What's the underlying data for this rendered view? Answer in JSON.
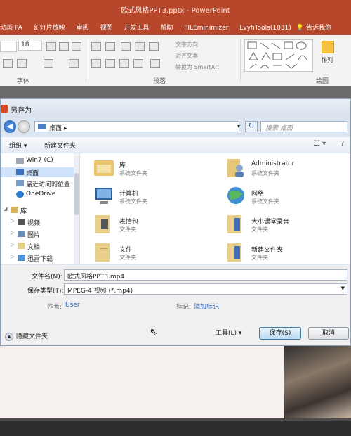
{
  "powerpoint": {
    "title": "欧式风格PPT3.pptx - PowerPoint",
    "menu": [
      "动画",
      "幻灯片放映",
      "审阅",
      "视图",
      "开发工具",
      "帮助",
      "FILEminimizer",
      "LvyhTools(1031)"
    ],
    "menu_partial_first": "动画 PA",
    "tell": "告诉我你",
    "ribbon_groups": [
      "字体",
      "段落",
      "绘图"
    ],
    "font_size": "18",
    "text_direction": "文字方向",
    "align_text": "对齐文本",
    "convert_smartart": "转换为 SmartArt",
    "arrange": "排列"
  },
  "dialog": {
    "title": "另存为",
    "address": "桌面",
    "address_arrow": "▸",
    "search_placeholder": "搜索 桌面",
    "toolbar": {
      "organize": "组织 ▾",
      "new_folder": "新建文件夹"
    },
    "nav_items": [
      {
        "label": "Win7 (C)"
      },
      {
        "label": "桌面"
      },
      {
        "label": "最近访问的位置"
      },
      {
        "label": "OneDrive"
      },
      {
        "label": "库"
      },
      {
        "label": "视频"
      },
      {
        "label": "图片"
      },
      {
        "label": "文档"
      },
      {
        "label": "迅雷下载"
      }
    ],
    "files": [
      {
        "name": "库",
        "type": "系统文件夹"
      },
      {
        "name": "Administrator",
        "type": "系统文件夹"
      },
      {
        "name": "计算机",
        "type": "系统文件夹"
      },
      {
        "name": "网络",
        "type": "系统文件夹"
      },
      {
        "name": "表情包",
        "type": "文件夹"
      },
      {
        "name": "大小课堂录音",
        "type": "文件夹"
      },
      {
        "name": "文件",
        "type": "文件夹"
      },
      {
        "name": "新建文件夹",
        "type": "文件夹"
      }
    ],
    "filename_label": "文件名(N):",
    "filename_value": "欧式风格PPT3.mp4",
    "savetype_label": "保存类型(T):",
    "savetype_value": "MPEG-4 视频 (*.mp4)",
    "author_label": "作者:",
    "author_value": "User",
    "tags_label": "标记:",
    "tags_value": "添加标记",
    "hide_folders": "隐藏文件夹",
    "tools": "工具(L)",
    "save": "保存(S)",
    "cancel": "取消"
  }
}
